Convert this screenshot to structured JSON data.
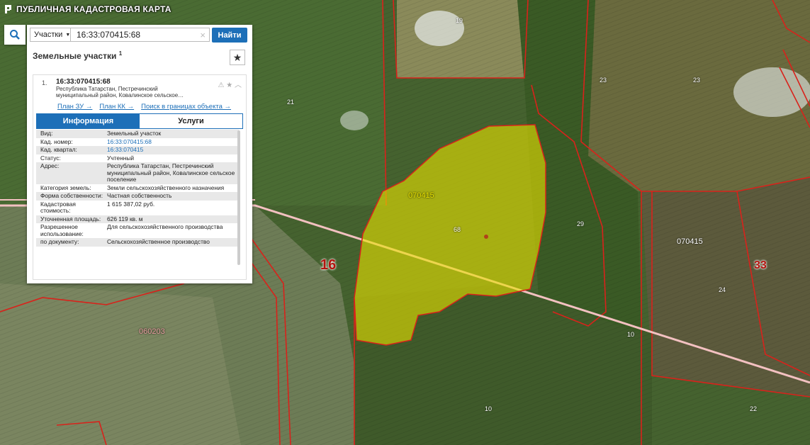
{
  "app": {
    "title": "ПУБЛИЧНАЯ КАДАСТРОВАЯ КАРТА"
  },
  "search": {
    "type_label": "Участки",
    "query": "16:33:070415:68",
    "button_label": "Найти"
  },
  "results": {
    "section_title": "Земельные участки",
    "count": "1",
    "item": {
      "index": "1.",
      "cad_number": "16:33:070415:68",
      "address": "Республика Татарстан, Пестречинский муниципальный район, Ковалинское сельское…",
      "links": [
        "План ЗУ →",
        "План КК →",
        "Поиск в границах объекта →"
      ],
      "tabs": [
        "Информация",
        "Услуги"
      ]
    }
  },
  "info": [
    {
      "k": "Вид:",
      "v": "Земельный участок"
    },
    {
      "k": "Кад. номер:",
      "v": "16:33:070415:68"
    },
    {
      "k": "Кад. квартал:",
      "v": "16:33:070415"
    },
    {
      "k": "Статус:",
      "v": "Учтенный"
    },
    {
      "k": "Адрес:",
      "v": "Республика Татарстан, Пестречинский муниципальный район, Ковалинское сельское поселение"
    },
    {
      "k": "Категория земель:",
      "v": "Земли сельскохозяйственного назначения"
    },
    {
      "k": "Форма собственности:",
      "v": "Частная собственность"
    },
    {
      "k": "Кадастровая стоимость:",
      "v": "1 615 387,02 руб."
    },
    {
      "k": "Уточненная площадь:",
      "v": "626 119 кв. м"
    },
    {
      "k": "Разрешенное использование:",
      "v": "Для сельскохозяйственного производства"
    },
    {
      "k": "по документу:",
      "v": "Сельскохозяйственное производство"
    }
  ],
  "map_labels": {
    "l19": "19",
    "l21": "21",
    "l23a": "23",
    "l23b": "23",
    "l070415a": "070415",
    "l68": "68",
    "l29": "29",
    "l070415b": "070415",
    "l16": "16",
    "l33": "33",
    "l24": "24",
    "l060203": "060203",
    "l10a": "10",
    "l10b": "10",
    "l22": "22"
  }
}
